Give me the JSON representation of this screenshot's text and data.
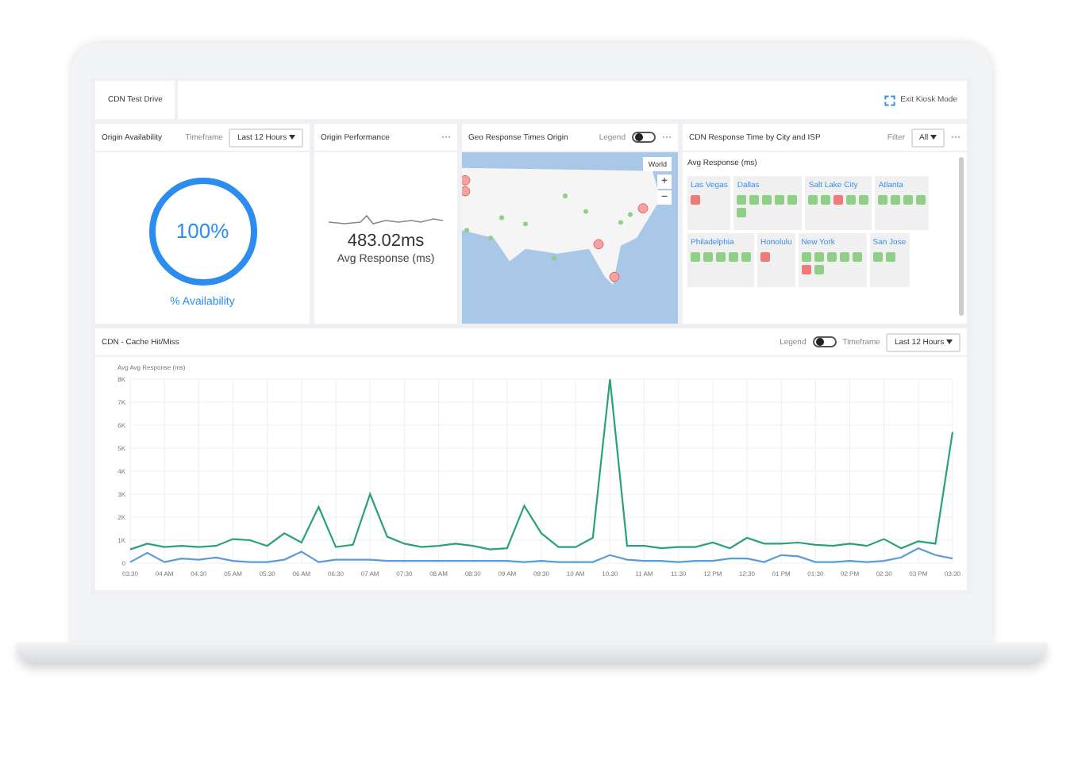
{
  "topbar": {
    "tab": "CDN Test Drive",
    "exit": "Exit Kiosk Mode"
  },
  "availability": {
    "title": "Origin Availability",
    "timeframe_label": "Timeframe",
    "timeframe": "Last 12 Hours",
    "value": "100%",
    "caption": "% Availability",
    "level": 1
  },
  "performance": {
    "title": "Origin Performance",
    "menu": "···",
    "value": "483.02ms",
    "caption": "Avg Response (ms)"
  },
  "geo": {
    "title": "Geo Response Times Origin",
    "legend_label": "Legend",
    "legend_on": false,
    "menu": "···",
    "region": "World",
    "zoom_in": "+",
    "zoom_out": "−"
  },
  "cdn": {
    "title": "CDN Response Time by City and ISP",
    "filter_label": "Filter",
    "filter": "All",
    "menu": "···",
    "subtitle": "Avg Response (ms)",
    "cities": [
      {
        "name": "Las Vegas",
        "squares": [
          {
            "color": "#f07a7a"
          }
        ]
      },
      {
        "name": "Dallas",
        "squares": [
          {
            "color": "#8fcf88"
          },
          {
            "color": "#8fcf88"
          },
          {
            "color": "#8fcf88"
          },
          {
            "color": "#8fcf88"
          },
          {
            "color": "#8fcf88"
          },
          {
            "color": "#8fcf88"
          }
        ]
      },
      {
        "name": "Salt Lake City",
        "squares": [
          {
            "color": "#8fcf88"
          },
          {
            "color": "#8fcf88"
          },
          {
            "color": "#f07a7a"
          },
          {
            "color": "#8fcf88"
          },
          {
            "color": "#8fcf88"
          }
        ]
      },
      {
        "name": "Atlanta",
        "squares": [
          {
            "color": "#8fcf88"
          },
          {
            "color": "#8fcf88"
          },
          {
            "color": "#8fcf88"
          },
          {
            "color": "#8fcf88"
          }
        ]
      },
      {
        "name": "Philadelphia",
        "squares": [
          {
            "color": "#8fcf88"
          },
          {
            "color": "#8fcf88"
          },
          {
            "color": "#8fcf88"
          },
          {
            "color": "#8fcf88"
          },
          {
            "color": "#8fcf88"
          }
        ]
      },
      {
        "name": "Honolulu",
        "squares": [
          {
            "color": "#f07a7a"
          }
        ]
      },
      {
        "name": "New York",
        "squares": [
          {
            "color": "#8fcf88"
          },
          {
            "color": "#8fcf88"
          },
          {
            "color": "#8fcf88"
          },
          {
            "color": "#8fcf88"
          },
          {
            "color": "#8fcf88"
          },
          {
            "color": "#f07a7a"
          },
          {
            "color": "#8fcf88"
          }
        ]
      },
      {
        "name": "San Jose",
        "squares": [
          {
            "color": "#8fcf88"
          },
          {
            "color": "#8fcf88"
          }
        ]
      }
    ]
  },
  "cache": {
    "title": "CDN - Cache Hit/Miss",
    "legend_label": "Legend",
    "legend_on": false,
    "timeframe_label": "Timeframe",
    "timeframe": "Last 12 Hours",
    "chart_data": {
      "type": "line",
      "ylabel": "Avg Avg Response (ms)",
      "x": [
        "03:30",
        null,
        "04 AM",
        null,
        "04:30",
        null,
        "05 AM",
        null,
        "05:30",
        null,
        "06 AM",
        null,
        "06:30",
        null,
        "07 AM",
        null,
        "07:30",
        null,
        "08 AM",
        null,
        "08:30",
        null,
        "09 AM",
        null,
        "09:30",
        null,
        "10 AM",
        null,
        "10:30",
        null,
        "11 AM",
        null,
        "11:30",
        null,
        "12 PM",
        null,
        "12:30",
        null,
        "01 PM",
        null,
        "01:30",
        null,
        "02 PM",
        null,
        "02:30",
        null,
        "03 PM",
        null,
        "03:30"
      ],
      "grid": true,
      "ylim": [
        0,
        8000
      ],
      "yticks": [
        {
          "value": 0,
          "label": "0"
        },
        {
          "value": 1000,
          "label": "1K"
        },
        {
          "value": 2000,
          "label": "2K"
        },
        {
          "value": 3000,
          "label": "3K"
        },
        {
          "value": 4000,
          "label": "4K"
        },
        {
          "value": 5000,
          "label": "5K"
        },
        {
          "value": 6000,
          "label": "6K"
        },
        {
          "value": 7000,
          "label": "7K"
        },
        {
          "value": 8000,
          "label": "8K"
        }
      ],
      "series": [
        {
          "color": "#2aa17c",
          "values": [
            600,
            850,
            700,
            750,
            700,
            750,
            1050,
            1000,
            750,
            1300,
            900,
            2450,
            700,
            800,
            3000,
            1150,
            850,
            700,
            750,
            850,
            750,
            600,
            650,
            2500,
            1300,
            700,
            700,
            1100,
            8000,
            750,
            750,
            650,
            700,
            700,
            900,
            650,
            1100,
            850,
            850,
            900,
            800,
            750,
            850,
            750,
            1050,
            650,
            950,
            850,
            5700
          ]
        },
        {
          "color": "#5b9bd8",
          "values": [
            50,
            450,
            50,
            200,
            150,
            250,
            100,
            50,
            50,
            150,
            500,
            50,
            150,
            150,
            150,
            100,
            100,
            100,
            100,
            100,
            100,
            100,
            100,
            50,
            100,
            50,
            50,
            50,
            350,
            150,
            100,
            100,
            50,
            100,
            100,
            200,
            200,
            50,
            350,
            300,
            50,
            50,
            100,
            50,
            100,
            250,
            650,
            350,
            200
          ]
        }
      ]
    }
  }
}
